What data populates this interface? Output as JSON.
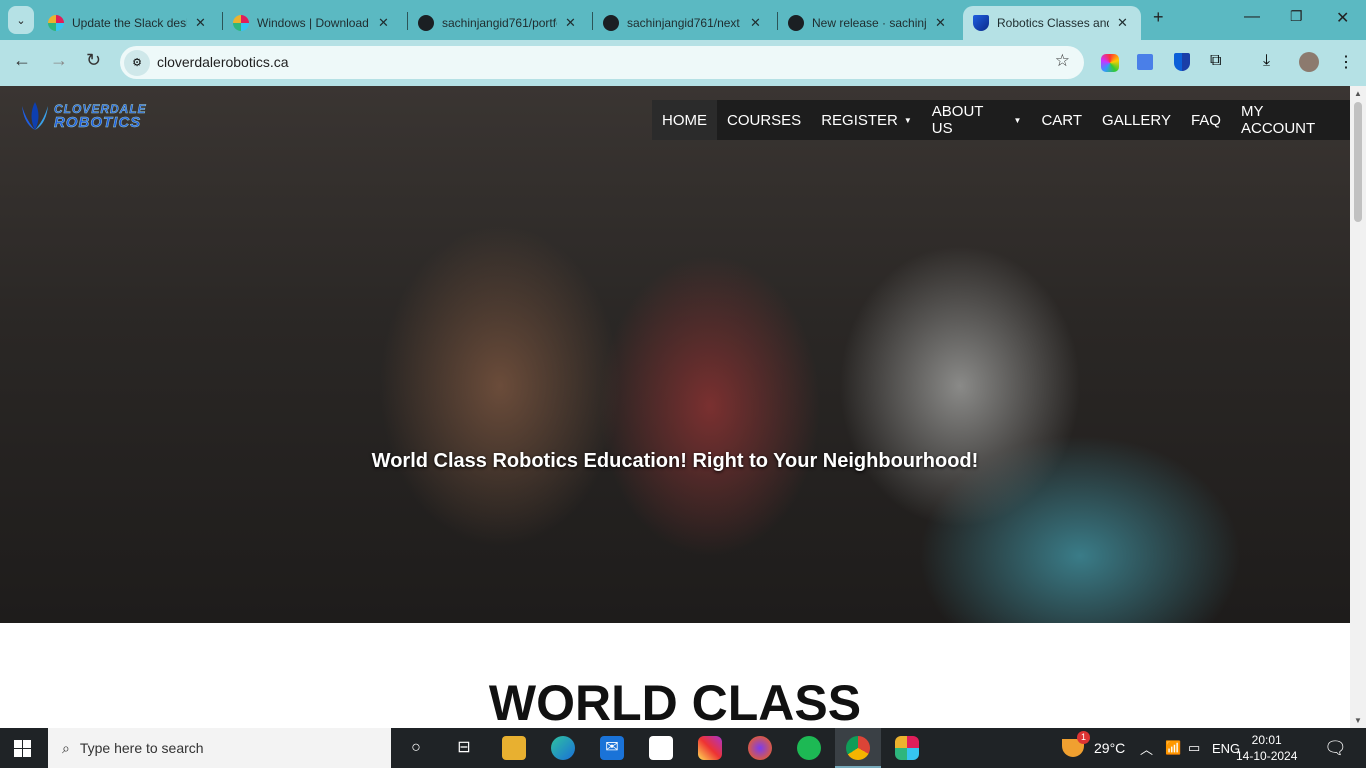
{
  "browser": {
    "tabs": [
      {
        "title": "Update the Slack desktop",
        "icon": "slack-icon"
      },
      {
        "title": "Windows | Download",
        "icon": "slack-icon"
      },
      {
        "title": "sachinjangid761/portfolio",
        "icon": "github-icon"
      },
      {
        "title": "sachinjangid761/next",
        "icon": "github-icon"
      },
      {
        "title": "New release · sachinjangid",
        "icon": "github-icon"
      },
      {
        "title": "Robotics Classes and",
        "icon": "cloverdale-icon",
        "active": true
      }
    ],
    "new_tab": "+",
    "url": "cloverdalerobotics.ca"
  },
  "site": {
    "logo": [
      "CLOVERDALE",
      "ROBOTICS"
    ],
    "menu": [
      {
        "label": "HOME"
      },
      {
        "label": "COURSES"
      },
      {
        "label": "REGISTER",
        "caret": "▼"
      },
      {
        "label": "ABOUT US",
        "caret": "▼"
      },
      {
        "label": "CART"
      },
      {
        "label": "GALLERY"
      },
      {
        "label": "FAQ"
      },
      {
        "label": "MY ACCOUNT"
      }
    ],
    "tagline": "World Class Robotics Education!  Right to Your Neighbourhood!",
    "heading": "WORLD CLASS",
    "brand_color": "#1f5ee0"
  },
  "taskbar": {
    "search_placeholder": "Type here to search",
    "weather": "29°C",
    "weather_badge": "1",
    "language": "ENG",
    "time": "20:01",
    "date": "14-10-2024"
  }
}
